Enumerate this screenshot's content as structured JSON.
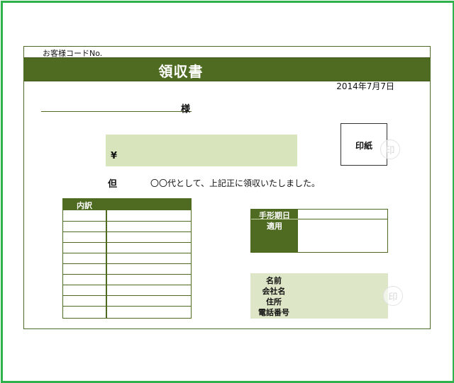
{
  "receipt": {
    "customer_code_label": "お客様コードNo.",
    "title": "領収書",
    "date": "2014年7月7日",
    "addressee_suffix": "様",
    "currency_symbol": "¥",
    "stamp_label": "印紙",
    "seal_glyph": "印",
    "tadashi": "但",
    "note": "〇〇代として、上記正に領収いたしました。"
  },
  "breakdown": {
    "header": "内訳",
    "row_count": 9
  },
  "bill": {
    "due_date_label": "手形期日",
    "remarks_label": "適用"
  },
  "issuer": {
    "labels": [
      "名前",
      "会社名",
      "住所",
      "電話番号"
    ]
  },
  "colors": {
    "frame": "#2fb14b",
    "accent": "#4f6b22",
    "light_fill": "#d8e4bc"
  }
}
